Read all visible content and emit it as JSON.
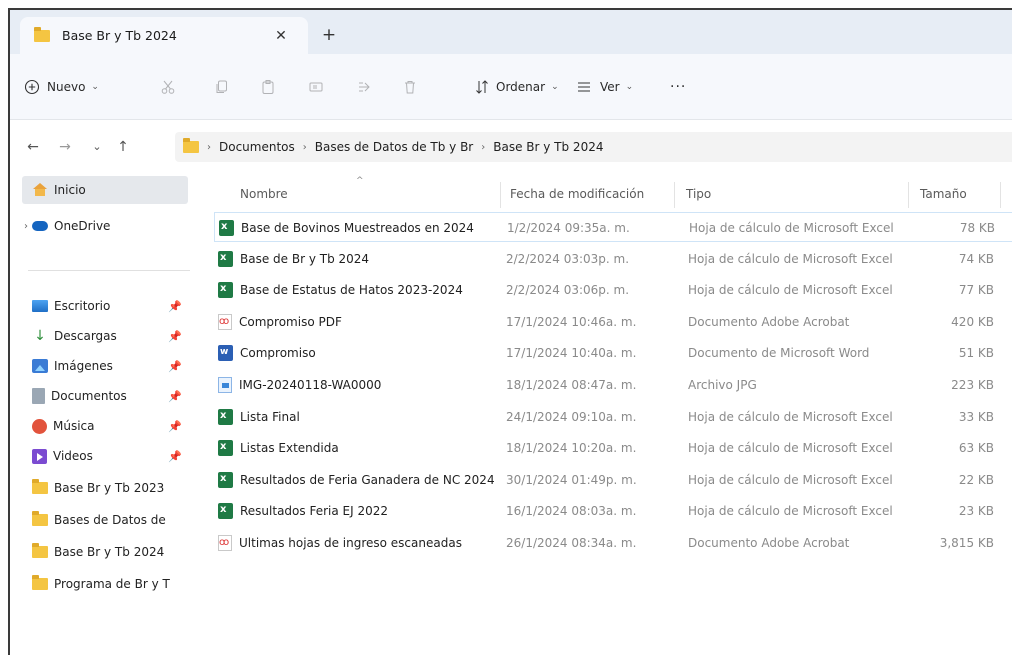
{
  "tab": {
    "title": "Base Br y Tb 2024",
    "close_glyph": "✕",
    "new_tab_glyph": "+"
  },
  "toolbar": {
    "nuevo_label": "Nuevo",
    "ordenar_label": "Ordenar",
    "ver_label": "Ver",
    "more_glyph": "···"
  },
  "address": {
    "crumbs": [
      "Documentos",
      "Bases de Datos de Tb y Br",
      "Base Br y Tb 2024"
    ]
  },
  "sidebar": {
    "items": [
      {
        "label": "Inicio",
        "icon": "home-icon",
        "selected": true
      },
      {
        "label": "OneDrive",
        "icon": "cloud-icon"
      },
      {
        "label": "Escritorio",
        "icon": "desktop-icon",
        "pinned": true
      },
      {
        "label": "Descargas",
        "icon": "download-icon",
        "pinned": true
      },
      {
        "label": "Imágenes",
        "icon": "images-icon",
        "pinned": true
      },
      {
        "label": "Documentos",
        "icon": "documents-icon",
        "pinned": true
      },
      {
        "label": "Música",
        "icon": "music-icon",
        "pinned": true
      },
      {
        "label": "Videos",
        "icon": "videos-icon",
        "pinned": true
      },
      {
        "label": "Base Br y Tb 2023",
        "icon": "folder-icon"
      },
      {
        "label": "Bases de Datos de",
        "icon": "folder-icon"
      },
      {
        "label": "Base Br y Tb 2024",
        "icon": "folder-icon"
      },
      {
        "label": "Programa de Br y T",
        "icon": "folder-icon"
      }
    ]
  },
  "columns": {
    "name": "Nombre",
    "date": "Fecha de modificación",
    "type": "Tipo",
    "size": "Tamaño"
  },
  "files": [
    {
      "name": "Base de Bovinos Muestreados en 2024",
      "date": "1/2/2024 09:35a. m.",
      "type": "Hoja de cálculo de Microsoft Excel",
      "size": "78 KB",
      "icon": "excel"
    },
    {
      "name": "Base de Br y Tb 2024",
      "date": "2/2/2024 03:03p. m.",
      "type": "Hoja de cálculo de Microsoft Excel",
      "size": "74 KB",
      "icon": "excel"
    },
    {
      "name": "Base de Estatus de Hatos 2023-2024",
      "date": "2/2/2024 03:06p. m.",
      "type": "Hoja de cálculo de Microsoft Excel",
      "size": "77 KB",
      "icon": "excel"
    },
    {
      "name": "Compromiso PDF",
      "date": "17/1/2024 10:46a. m.",
      "type": "Documento Adobe Acrobat",
      "size": "420 KB",
      "icon": "pdf"
    },
    {
      "name": "Compromiso",
      "date": "17/1/2024 10:40a. m.",
      "type": "Documento de Microsoft Word",
      "size": "51 KB",
      "icon": "word"
    },
    {
      "name": "IMG-20240118-WA0000",
      "date": "18/1/2024 08:47a. m.",
      "type": "Archivo JPG",
      "size": "223 KB",
      "icon": "jpg"
    },
    {
      "name": "Lista Final",
      "date": "24/1/2024 09:10a. m.",
      "type": "Hoja de cálculo de Microsoft Excel",
      "size": "33 KB",
      "icon": "excel"
    },
    {
      "name": "Listas Extendida",
      "date": "18/1/2024 10:20a. m.",
      "type": "Hoja de cálculo de Microsoft Excel",
      "size": "63 KB",
      "icon": "excel"
    },
    {
      "name": "Resultados de Feria Ganadera de NC 2024",
      "date": "30/1/2024 01:49p. m.",
      "type": "Hoja de cálculo de Microsoft Excel",
      "size": "22 KB",
      "icon": "excel"
    },
    {
      "name": "Resultados Feria EJ 2022",
      "date": "16/1/2024 08:03a. m.",
      "type": "Hoja de cálculo de Microsoft Excel",
      "size": "23 KB",
      "icon": "excel"
    },
    {
      "name": "Ultimas hojas de ingreso escaneadas",
      "date": "26/1/2024 08:34a. m.",
      "type": "Documento Adobe Acrobat",
      "size": "3,815 KB",
      "icon": "pdf"
    }
  ]
}
